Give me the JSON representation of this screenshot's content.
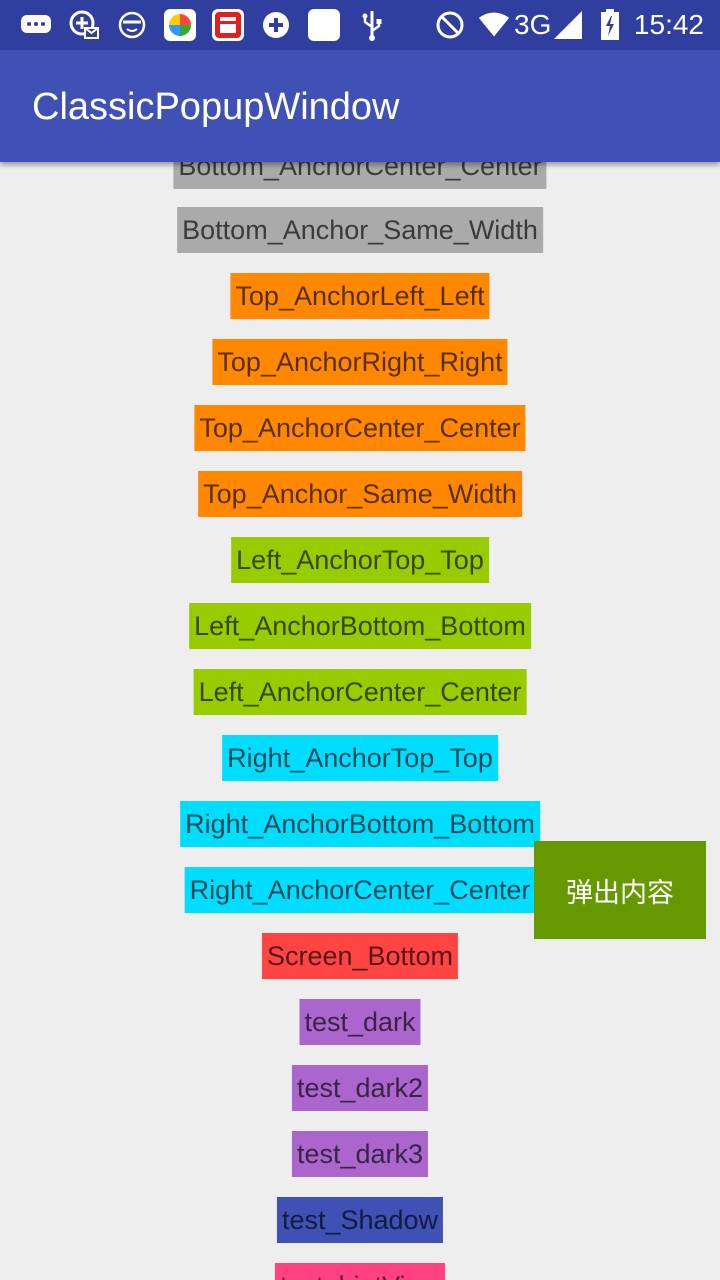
{
  "status_bar": {
    "time": "15:42",
    "network": "3G",
    "icons": [
      "chat-bubble-icon",
      "camera-mail-icon",
      "face-icon",
      "color-wheel-app-icon",
      "red-news-app-icon",
      "plus-circle-icon",
      "blank-app-icon",
      "usb-icon",
      "do-not-disturb-icon",
      "wifi-icon",
      "signal-icon",
      "battery-icon"
    ],
    "colors": {
      "background": "#303f9f"
    }
  },
  "app_bar": {
    "title": "ClassicPopupWindow",
    "colors": {
      "background": "#3f51b5",
      "text": "#ffffff"
    }
  },
  "buttons": [
    {
      "label": "Bottom_AnchorCenter_Center",
      "color": "#aaaaaa"
    },
    {
      "label": "Bottom_Anchor_Same_Width",
      "color": "#aaaaaa"
    },
    {
      "label": "Top_AnchorLeft_Left",
      "color": "#ff8800"
    },
    {
      "label": "Top_AnchorRight_Right",
      "color": "#ff8800"
    },
    {
      "label": "Top_AnchorCenter_Center",
      "color": "#ff8800"
    },
    {
      "label": "Top_Anchor_Same_Width",
      "color": "#ff8800"
    },
    {
      "label": "Left_AnchorTop_Top",
      "color": "#99cc00"
    },
    {
      "label": "Left_AnchorBottom_Bottom",
      "color": "#99cc00"
    },
    {
      "label": "Left_AnchorCenter_Center",
      "color": "#99cc00"
    },
    {
      "label": "Right_AnchorTop_Top",
      "color": "#00ddff"
    },
    {
      "label": "Right_AnchorBottom_Bottom",
      "color": "#00ddff"
    },
    {
      "label": "Right_AnchorCenter_Center",
      "color": "#00ddff"
    },
    {
      "label": "Screen_Bottom",
      "color": "#ff4444"
    },
    {
      "label": "test_dark",
      "color": "#aa66cc"
    },
    {
      "label": "test_dark2",
      "color": "#aa66cc"
    },
    {
      "label": "test_dark3",
      "color": "#aa66cc"
    },
    {
      "label": "test_Shadow",
      "color": "#3f51b5"
    },
    {
      "label": "test_hintView",
      "color": "#ff4081"
    }
  ],
  "popup": {
    "text": "弹出内容",
    "color": "#669900"
  }
}
